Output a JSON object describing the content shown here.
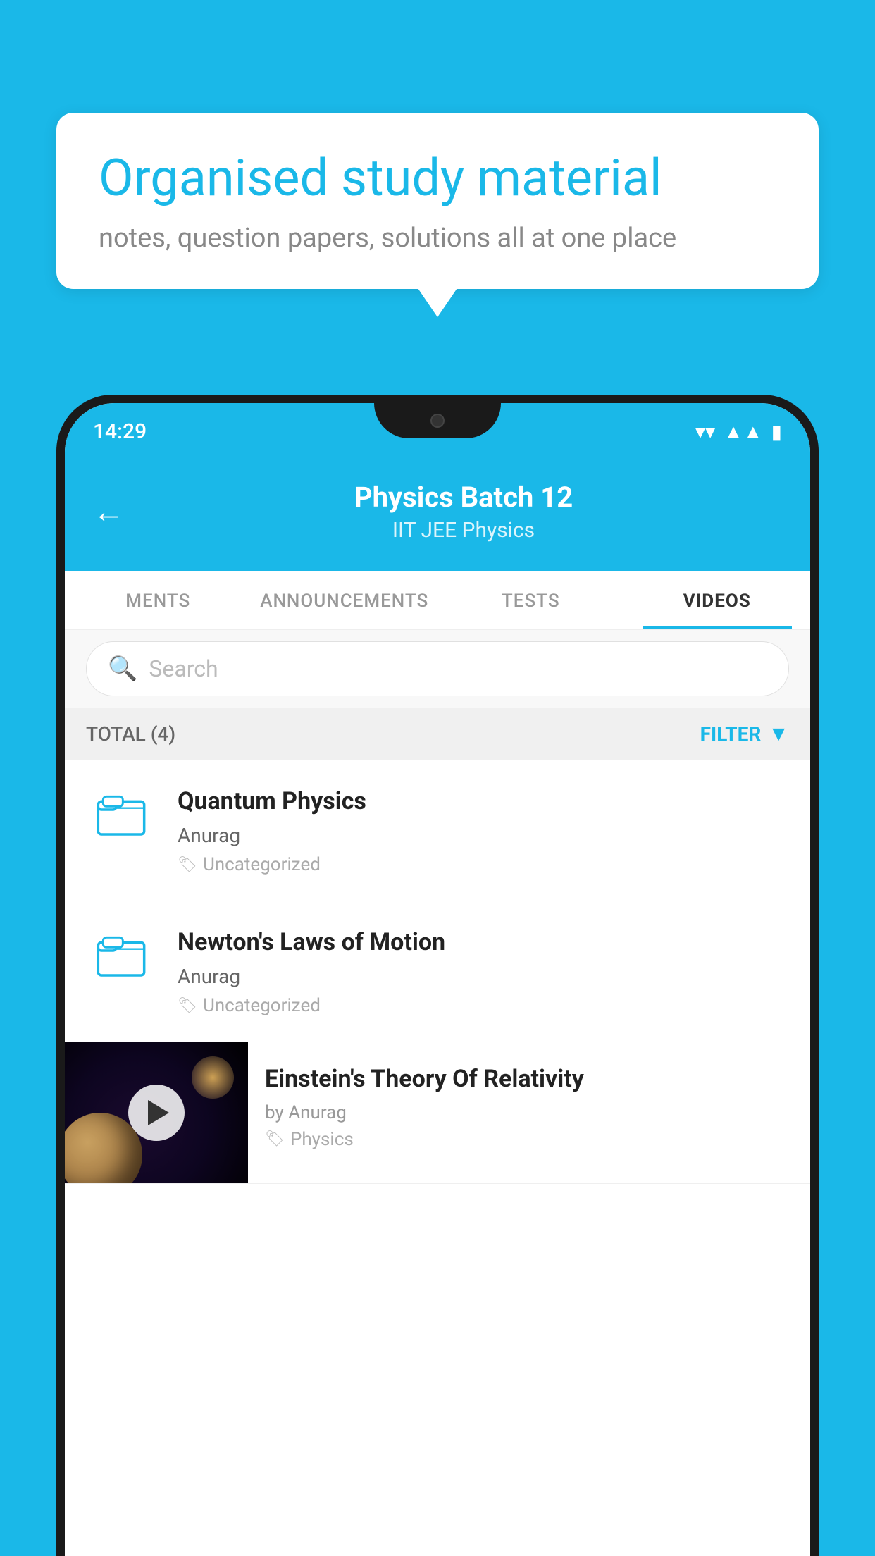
{
  "background_color": "#1ab8e8",
  "bubble": {
    "title": "Organised study material",
    "subtitle": "notes, question papers, solutions all at one place"
  },
  "phone": {
    "status_bar": {
      "time": "14:29",
      "wifi_icon": "▼",
      "signal_icon": "▲",
      "battery_icon": "▮"
    },
    "app_bar": {
      "back_label": "←",
      "title": "Physics Batch 12",
      "subtitle": "IIT JEE   Physics"
    },
    "tabs": [
      {
        "label": "MENTS",
        "active": false
      },
      {
        "label": "ANNOUNCEMENTS",
        "active": false
      },
      {
        "label": "TESTS",
        "active": false
      },
      {
        "label": "VIDEOS",
        "active": true
      }
    ],
    "search": {
      "placeholder": "Search"
    },
    "filter_row": {
      "total_label": "TOTAL (4)",
      "filter_label": "FILTER"
    },
    "video_items": [
      {
        "title": "Quantum Physics",
        "author": "Anurag",
        "tag": "Uncategorized",
        "has_thumbnail": false
      },
      {
        "title": "Newton's Laws of Motion",
        "author": "Anurag",
        "tag": "Uncategorized",
        "has_thumbnail": false
      },
      {
        "title": "Einstein's Theory Of Relativity",
        "author": "by Anurag",
        "tag": "Physics",
        "has_thumbnail": true
      }
    ]
  }
}
